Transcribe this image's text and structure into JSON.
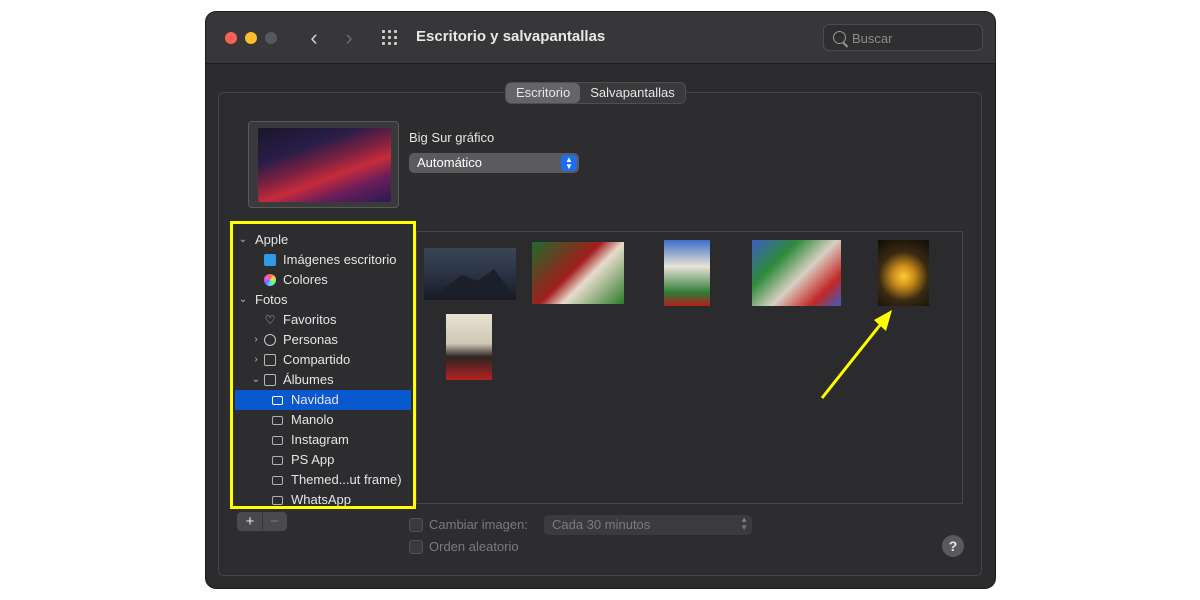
{
  "window": {
    "title": "Escritorio y salvapantallas"
  },
  "search": {
    "placeholder": "Buscar"
  },
  "tabs": [
    {
      "label": "Escritorio",
      "active": true
    },
    {
      "label": "Salvapantallas",
      "active": false
    }
  ],
  "wallpaper": {
    "name": "Big Sur gráfico",
    "mode": "Automático"
  },
  "sidebar": {
    "groups": [
      {
        "label": "Apple",
        "items": [
          {
            "label": "Imágenes escritorio",
            "icon": "folder-icon"
          },
          {
            "label": "Colores",
            "icon": "colors-icon"
          }
        ]
      },
      {
        "label": "Fotos",
        "items": [
          {
            "label": "Favoritos",
            "icon": "heart-icon"
          },
          {
            "label": "Personas",
            "icon": "person-icon"
          },
          {
            "label": "Compartido",
            "icon": "shared-icon"
          },
          {
            "label": "Álbumes",
            "icon": "albums-icon"
          }
        ]
      }
    ],
    "albums": [
      {
        "label": "Navidad",
        "selected": true
      },
      {
        "label": "Manolo"
      },
      {
        "label": "Instagram"
      },
      {
        "label": "PS App"
      },
      {
        "label": "Themed...ut frame)"
      },
      {
        "label": "WhatsApp"
      }
    ]
  },
  "options": {
    "change_picture": "Cambiar imagen:",
    "interval": "Cada 30 minutos",
    "random_order": "Orden aleatorio"
  },
  "buttons": {
    "add": "+",
    "remove": "−",
    "help": "?"
  },
  "colors": {
    "highlight": "#ffff00",
    "selection": "#0a58d0",
    "accent": "#1b6ef3"
  }
}
